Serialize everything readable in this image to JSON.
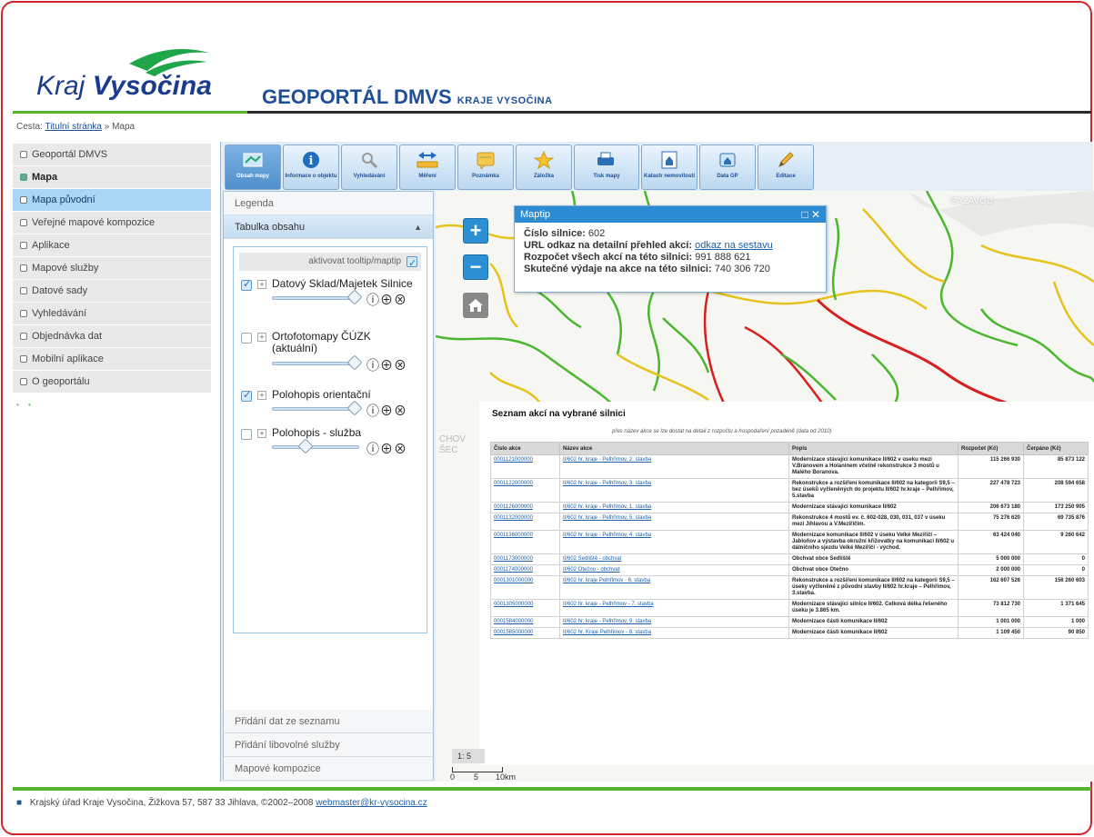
{
  "header": {
    "logo_light": "Kraj ",
    "logo_bold": "Vysočina",
    "title_main": "GEOPORTÁL DMVS",
    "title_sub": "KRAJE VYSOČINA"
  },
  "breadcrumb": {
    "prefix": "Cesta:",
    "home": "Titulní stránka",
    "sep": "»",
    "current": "Mapa"
  },
  "menu": {
    "items": [
      {
        "label": "Geoportál DMVS"
      },
      {
        "label": "Mapa"
      },
      {
        "label": "Mapa původní"
      },
      {
        "label": "Veřejné mapové kompozice"
      },
      {
        "label": "Aplikace"
      },
      {
        "label": "Mapové služby"
      },
      {
        "label": "Datové sady"
      },
      {
        "label": "Vyhledávání"
      },
      {
        "label": "Objednávka dat"
      },
      {
        "label": "Mobilní aplikace"
      },
      {
        "label": "O geoportálu"
      }
    ],
    "dots": "• •"
  },
  "toolbar": {
    "tools": [
      {
        "label": "Obsah mapy",
        "icon": "map-content-icon"
      },
      {
        "label": "Informace o objektu",
        "icon": "info-icon"
      },
      {
        "label": "Vyhledávání",
        "icon": "search-icon"
      },
      {
        "label": "Měření",
        "icon": "measure-icon"
      },
      {
        "label": "Poznámka",
        "icon": "note-icon"
      },
      {
        "label": "Záložka",
        "icon": "bookmark-icon"
      },
      {
        "label": "Tisk mapy",
        "icon": "print-icon"
      },
      {
        "label": "Katastr nemovitostí",
        "icon": "cadastre-icon"
      },
      {
        "label": "Data GP",
        "icon": "data-icon"
      },
      {
        "label": "Editace",
        "icon": "edit-icon"
      }
    ]
  },
  "panel": {
    "legend": "Legenda",
    "toc_header": "Tabulka obsahu",
    "toc_chevron": "▲",
    "tooltip_toggle": "aktivovat tooltip/maptip",
    "layers": [
      {
        "name": "Datový Sklad/Majetek Silnice",
        "checked": true
      },
      {
        "name": "Ortofotomapy ČÚZK (aktuální)",
        "checked": false
      },
      {
        "name": "Polohopis orientační",
        "checked": true
      },
      {
        "name": "Polohopis - služba",
        "checked": false
      }
    ],
    "layer_icons": "ⓘ⊕⊗",
    "add_list": "Přidání dat ze seznamu",
    "add_service": "Přidání libovolné služby",
    "compositions": "Mapové kompozice"
  },
  "map": {
    "zoom_in": "+",
    "zoom_out": "−",
    "maptip": {
      "title": "Maptip",
      "controls": "□ ✕",
      "road_label": "Číslo silnice:",
      "road_value": "602",
      "url_label": "URL odkaz na detailní přehled akcí:",
      "url_link": "odkaz na sestavu",
      "budget_label": "Rozpočet všech akcí na této silnici:",
      "budget_value": "991 888 621",
      "spent_label": "Skutečné výdaje na akce na této silnici:",
      "spent_value": "740 306 720"
    },
    "place_labels": {
      "top_right": "SÁZAVOU",
      "left": "CHOV",
      "left2": "ŠEC"
    },
    "scale_text": "1: 5",
    "scale_labels": [
      "0",
      "5",
      "10km"
    ]
  },
  "action_list": {
    "title": "Seznam akcí na vybrané silnici",
    "note": "přes název akce se lze dostat na detail z rozpočtu a hospodaření pozadéně (data od 2010)",
    "columns": [
      "Číslo akce",
      "Název akce",
      "Popis",
      "Rozpočet (Kč)",
      "Čerpáno (Kč)"
    ],
    "rows": [
      {
        "id": "0001121000000",
        "name": "II/602 hr. kraje - Pelhřimov, 2. stavba",
        "desc": "Modernizace stávající komunikace II/602 v úseku mezi V.Bránovem a Holaninem včetně rekonstrukce 3 mostů u Malého Boranova.",
        "budget": "115 266 930",
        "spent": "85 873 122"
      },
      {
        "id": "0001122000000",
        "name": "II/602 hr. kraje - Pelhřimov, 3. stavba",
        "desc": "Rekonstrukce a rozšíření komunikace II/602 na kategorii S9,5 – bez úseků vyčleněných do projektu II/602 hr.kraje – Pelhřimov, 5.stavba",
        "budget": "227 478 723",
        "spent": "208 594 658"
      },
      {
        "id": "0001126000000",
        "name": "II/602 hr. kraje - Pelhřimov, 1. stavba",
        "desc": "Modernizace stávající komunikace II/602",
        "budget": "206 673 180",
        "spent": "173 250 905"
      },
      {
        "id": "0001132000000",
        "name": "II/602 hr. kraje - Pelhřimov, 5. stavba",
        "desc": "Rekonstrukce 4 mostů ev. č. 602-028, 030, 031, 037 v úseku mezi Jihlavou a V.Meziříčím.",
        "budget": "75 276 620",
        "spent": "69 735 876"
      },
      {
        "id": "0001136000000",
        "name": "II/602 hr. kraje - Pelhřimov, 4. stavba",
        "desc": "Modernizace komunikace II/602 v úseku Velké Meziříčí – Jabloňov a výstavba okružní křižovatky na komunikaci II/602 u dálničního sjezdu Velké Meziříčí - východ.",
        "budget": "63 424 040",
        "spent": "9 260 642"
      },
      {
        "id": "0001173000000",
        "name": "II/602 Sedliště - obchvat",
        "desc": "Obchvat obce Sedliště",
        "budget": "5 000 000",
        "spent": "0"
      },
      {
        "id": "0001174000000",
        "name": "II/602 Otečno - obchvat",
        "desc": "Obchvat obce Otečno",
        "budget": "2 000 000",
        "spent": "0"
      },
      {
        "id": "0001301000000",
        "name": "II/602 hr. kraje Pelhřimov - 6. stavba",
        "desc": "Rekonstrukce a rozšíření komunikace II/602 na kategorii S9,5 – úseky vyčleněné z původní stavby II/602 hr.kraje – Pelhřimov, 3.stavba.",
        "budget": "162 607 526",
        "spent": "156 260 603"
      },
      {
        "id": "0001305000000",
        "name": "II/602 hr. kraje - Pelhřimov - 7. stavba",
        "desc": "Modernizace stávající silnice II/602. Celková délka řešeného úseku je 3.865 km.",
        "budget": "73 812 730",
        "spent": "1 371 645"
      },
      {
        "id": "0001584000000",
        "name": "II/602 hr. kraje - Pelhřimov, 9. stavba",
        "desc": "Modernizace části komunikace II/602",
        "budget": "1 001 000",
        "spent": "1 000"
      },
      {
        "id": "0001585000000",
        "name": "II/602 hr. Kraje Pelhřimov - 8. stavba",
        "desc": "Modernizace části komunikace II/602",
        "budget": "1 109 450",
        "spent": "90 850"
      }
    ]
  },
  "footer": {
    "bullet": "■",
    "text": "Krajský úřad Kraje Vysočina, Žižkova 57, 587 33 Jihlava, ©2002–2008",
    "email": "webmaster@kr-vysocina.cz"
  },
  "colors": {
    "accent": "#2d8bd1",
    "green": "#55b52f",
    "border": "#d4242a",
    "brand": "#1e4f97"
  }
}
